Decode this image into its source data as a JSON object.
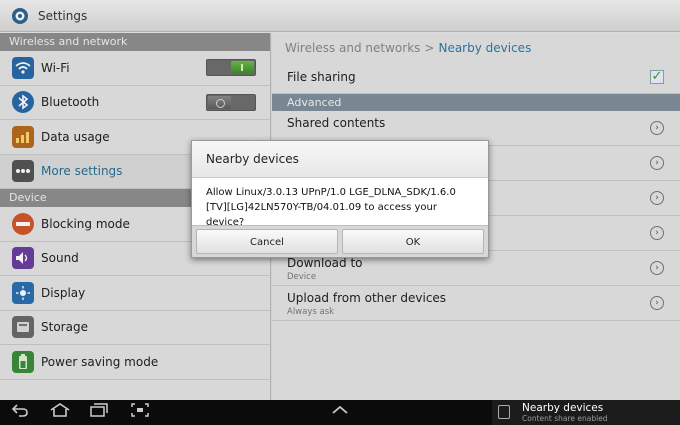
{
  "titlebar": {
    "title": "Settings"
  },
  "left": {
    "sections": [
      {
        "header": "Wireless and network",
        "items": [
          {
            "label": "Wi-Fi",
            "icon": "wifi-icon",
            "toggle": "on"
          },
          {
            "label": "Bluetooth",
            "icon": "bluetooth-icon",
            "toggle": "off"
          },
          {
            "label": "Data usage",
            "icon": "data-usage-icon"
          },
          {
            "label": "More settings",
            "icon": "more-settings-icon",
            "selected": true
          }
        ]
      },
      {
        "header": "Device",
        "items": [
          {
            "label": "Blocking mode",
            "icon": "blocking-mode-icon"
          },
          {
            "label": "Sound",
            "icon": "sound-icon"
          },
          {
            "label": "Display",
            "icon": "display-icon"
          },
          {
            "label": "Storage",
            "icon": "storage-icon"
          },
          {
            "label": "Power saving mode",
            "icon": "power-saving-icon"
          }
        ]
      }
    ]
  },
  "right": {
    "breadcrumb": {
      "parent": "Wireless and networks",
      "separator": ">",
      "current": "Nearby devices"
    },
    "file_sharing": {
      "label": "File sharing",
      "checked": true
    },
    "advanced_header": "Advanced",
    "items": [
      {
        "label": "Shared contents",
        "sub": ""
      },
      {
        "label": "",
        "sub": ""
      },
      {
        "label": "",
        "sub": ""
      },
      {
        "label": "",
        "sub": ""
      },
      {
        "label": "Download to",
        "sub": "Device"
      },
      {
        "label": "Upload from other devices",
        "sub": "Always ask"
      }
    ]
  },
  "dialog": {
    "title": "Nearby devices",
    "message": "Allow Linux/3.0.13 UPnP/1.0 LGE_DLNA_SDK/1.6.0 [TV][LG]42LN570Y-TB/04.01.09  to access your device?",
    "cancel": "Cancel",
    "ok": "OK"
  },
  "notification": {
    "title": "Nearby devices",
    "subtitle": "Content share enabled"
  },
  "colors": {
    "accent": "#2f7aa3",
    "check": "#3b9c2e",
    "toggle_on": "#4fa536"
  }
}
